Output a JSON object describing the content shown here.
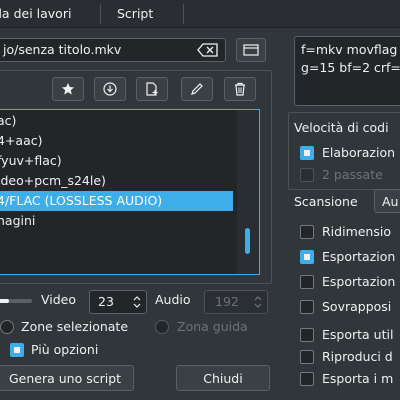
{
  "menubar": {
    "items": [
      "da dei lavori",
      "Script"
    ]
  },
  "file": {
    "path": "jo/senza titolo.mkv"
  },
  "presets": {
    "items": [
      "ac)",
      "4+aac)",
      "fyuv+flac)",
      "ideo+pcm_s24le)",
      "4/FLAC (LOSSLESS AUDIO)",
      "nagini"
    ],
    "selected_index": 4
  },
  "quality": {
    "video_label": "Video",
    "video_value": "23",
    "audio_label": "Audio",
    "audio_value": "192",
    "slider_fraction": 0.35
  },
  "zones": {
    "selected_label": "Zone selezionate",
    "guide_label": "Zona guida"
  },
  "options": {
    "more_label": "Più opzioni",
    "more_checked": true
  },
  "buttons": {
    "script_label": "Genera uno script",
    "close_label": "Chiudi"
  },
  "right": {
    "command_text": "f=mkv movflag\ng=15 bf=2 crf=",
    "speed_label": "Velocità di codi",
    "parallel_label": "Elaborazion",
    "twopass_label": "2 passate",
    "scan_label": "Scansione",
    "scan_value": "Au",
    "checks": [
      {
        "label": "Ridimensio",
        "checked": false
      },
      {
        "label": "Esportazion",
        "checked": true
      },
      {
        "label": "Esportazion",
        "checked": false
      },
      {
        "label": "Sovrapposi",
        "checked": false
      },
      {
        "label": "Esporta util",
        "checked": false
      },
      {
        "label": "Riproduci d",
        "checked": false
      },
      {
        "label": "Esporta i m",
        "checked": false
      }
    ]
  },
  "colors": {
    "accent": "#3daee9",
    "background": "#31363b",
    "field": "#232629"
  }
}
